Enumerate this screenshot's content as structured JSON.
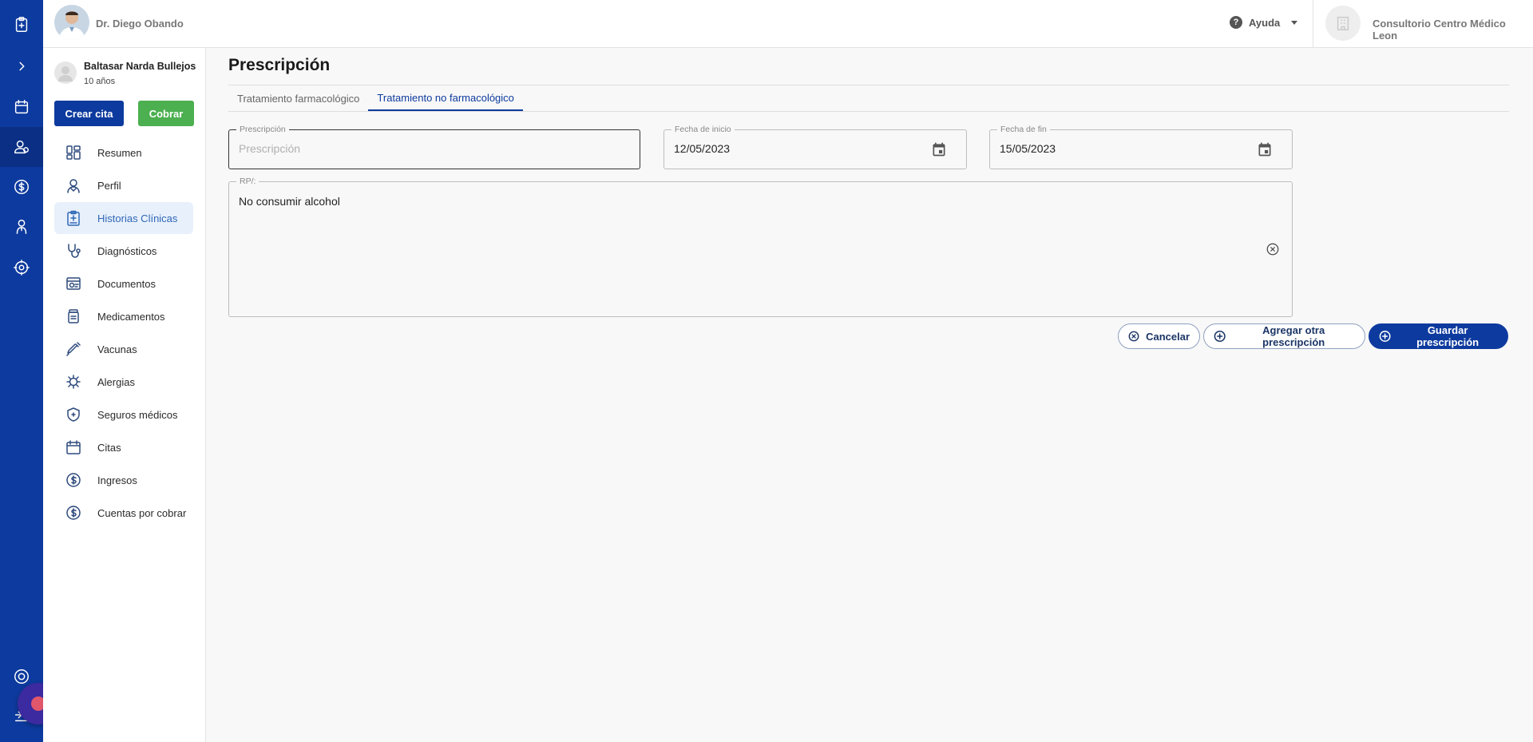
{
  "header": {
    "doctor_name": "Dr. Diego Obando",
    "help_label": "Ayuda",
    "clinic_name": "Consultorio Centro Médico Leon"
  },
  "patient": {
    "name": "Baltasar Narda Bullejos",
    "age": "10 años",
    "create_appointment_label": "Crear cita",
    "charge_label": "Cobrar"
  },
  "menu": {
    "items": [
      {
        "label": "Resumen",
        "icon": "dashboard-icon"
      },
      {
        "label": "Perfil",
        "icon": "user-icon"
      },
      {
        "label": "Historias Clínicas",
        "icon": "clinical-record-icon",
        "active": true
      },
      {
        "label": "Diagnósticos",
        "icon": "stethoscope-icon"
      },
      {
        "label": "Documentos",
        "icon": "documents-icon"
      },
      {
        "label": "Medicamentos",
        "icon": "medicine-icon"
      },
      {
        "label": "Vacunas",
        "icon": "syringe-icon"
      },
      {
        "label": "Alergias",
        "icon": "allergy-icon"
      },
      {
        "label": "Seguros médicos",
        "icon": "shield-icon"
      },
      {
        "label": "Citas",
        "icon": "calendar-icon"
      },
      {
        "label": "Ingresos",
        "icon": "dollar-icon"
      },
      {
        "label": "Cuentas por cobrar",
        "icon": "dollar-icon"
      }
    ]
  },
  "main": {
    "title": "Prescripción",
    "tabs": [
      {
        "label": "Tratamiento farmacológico",
        "active": false
      },
      {
        "label": "Tratamiento no farmacológico",
        "active": true
      }
    ],
    "form": {
      "prescription_label": "Prescripción",
      "prescription_placeholder": "Prescripción",
      "start_date_label": "Fecha de inicio",
      "start_date_value": "12/05/2023",
      "end_date_label": "Fecha de fin",
      "end_date_value": "15/05/2023",
      "rp_label": "RP/:",
      "rp_value": "No consumir alcohol"
    },
    "actions": {
      "cancel_label": "Cancelar",
      "add_label": "Agregar otra prescripción",
      "save_label": "Guardar prescripción"
    }
  },
  "colors": {
    "primary": "#0d3a9e",
    "success": "#4caf50",
    "active_menu_bg": "#e8f0fb",
    "active_menu_text": "#2f67b7"
  }
}
